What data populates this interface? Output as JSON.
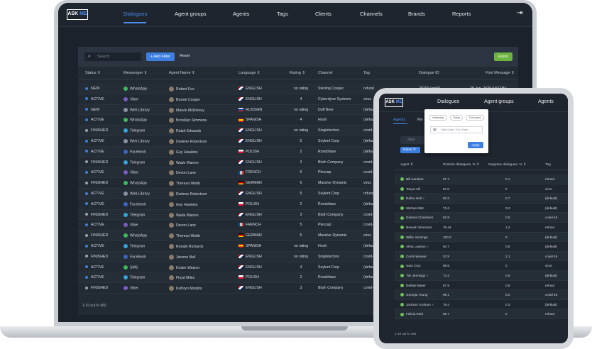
{
  "laptop": {
    "logo": {
      "left": "ASK",
      "right": "ME"
    },
    "nav": [
      "Dialogues",
      "Agent groups",
      "Agents",
      "Tags",
      "Clients",
      "Channels",
      "Brands",
      "Reports"
    ],
    "active_nav": "Dialogues",
    "filter": {
      "search_placeholder": "Search",
      "add_filter": "+ Add Filter",
      "reset": "Reset",
      "excel": "Excel"
    },
    "columns": [
      "Status ⇕",
      "Messenger ⇕",
      "Agent Name ⇕",
      "Language ⇕",
      "Rating ⇕",
      "Channel",
      "Tag",
      "Dialogue ID",
      "First Message ⇕"
    ],
    "rows": [
      {
        "status": "NEW",
        "status_color": "#3d7fe0",
        "messenger": "WhatsApp",
        "msg_color": "#3dbb5a",
        "agent": "Robert Fox",
        "language": "ENGLISH",
        "flag": "en",
        "rating": "no rating",
        "channel": "Sterling Cooper",
        "tag": "refund",
        "dialogue_id": "28200-kqp93...",
        "first_message": "28 Jan, 2020 6:57 PM"
      },
      {
        "status": "ACTIVE",
        "status_color": "#3d7fe0",
        "messenger": "Viber",
        "msg_color": "#7a5bc7",
        "agent": "Bessie Cooper",
        "language": "ENGLISH",
        "flag": "en",
        "rating": "4",
        "channel": "Cyberdyne Systems",
        "tag": "virus",
        "dialogue_id": "",
        "first_message": ""
      },
      {
        "status": "NEW",
        "status_color": "#3d7fe0",
        "messenger": "Web Library",
        "msg_color": "#8b93a0",
        "agent": "Marvin McKinney",
        "language": "RUSSIAN",
        "flag": "ru",
        "rating": "no rating",
        "channel": "Duff Beer",
        "tag": "(default)",
        "dialogue_id": "",
        "first_message": ""
      },
      {
        "status": "ACTIVE",
        "status_color": "#3d7fe0",
        "messenger": "WhatsApp",
        "msg_color": "#3dbb5a",
        "agent": "Brooklyn Simmons",
        "language": "SPANISH",
        "flag": "es",
        "rating": "4",
        "channel": "Hooli",
        "tag": "(default)",
        "dialogue_id": "",
        "first_message": ""
      },
      {
        "status": "FINISHED",
        "status_color": "#9aa2ad",
        "messenger": "Telegram",
        "msg_color": "#36a3dc",
        "agent": "Ralph Edwards",
        "language": "ENGLISH",
        "flag": "en",
        "rating": "no rating",
        "channel": "Singletechno",
        "tag": "covid-",
        "dialogue_id": "",
        "first_message": ""
      },
      {
        "status": "ACTIVE",
        "status_color": "#3d7fe0",
        "messenger": "Web Library",
        "msg_color": "#8b93a0",
        "agent": "Darlene Robertson",
        "language": "ENGLISH",
        "flag": "en",
        "rating": "5",
        "channel": "Soylent Corp",
        "tag": "(defau",
        "dialogue_id": "",
        "first_message": ""
      },
      {
        "status": "ACTIVE",
        "status_color": "#3d7fe0",
        "messenger": "Facebook",
        "msg_color": "#3b66c4",
        "agent": "Guy Hawkins",
        "language": "POLISH",
        "flag": "pl",
        "rating": "2",
        "channel": "Rundofase",
        "tag": "(defau",
        "dialogue_id": "",
        "first_message": ""
      },
      {
        "status": "FINISHED",
        "status_color": "#9aa2ad",
        "messenger": "Telegram",
        "msg_color": "#36a3dc",
        "agent": "Wade Warren",
        "language": "ENGLISH",
        "flag": "en",
        "rating": "3",
        "channel": "Bluth Company",
        "tag": "covid-",
        "dialogue_id": "",
        "first_message": ""
      },
      {
        "status": "ACTIVE",
        "status_color": "#3d7fe0",
        "messenger": "Viber",
        "msg_color": "#7a5bc7",
        "agent": "Devon Lane",
        "language": "FRENCH",
        "flag": "fr",
        "rating": "5",
        "channel": "Plexzap",
        "tag": "covid-",
        "dialogue_id": "",
        "first_message": ""
      },
      {
        "status": "FINISHED",
        "status_color": "#9aa2ad",
        "messenger": "WhatsApp",
        "msg_color": "#3dbb5a",
        "agent": "Theresa Webb",
        "language": "GERMAN",
        "flag": "de",
        "rating": "5",
        "channel": "Massive Dynamic",
        "tag": "virus",
        "dialogue_id": "",
        "first_message": ""
      },
      {
        "status": "ACTIVE",
        "status_color": "#3d7fe0",
        "messenger": "Web Library",
        "msg_color": "#8b93a0",
        "agent": "Darlene Robertson",
        "language": "ENGLISH",
        "flag": "en",
        "rating": "5",
        "channel": "Soylent Corp",
        "tag": "refund",
        "dialogue_id": "",
        "first_message": ""
      },
      {
        "status": "ACTIVE",
        "status_color": "#3d7fe0",
        "messenger": "Facebook",
        "msg_color": "#3b66c4",
        "agent": "Guy Hawkins",
        "language": "POLISH",
        "flag": "pl",
        "rating": "2",
        "channel": "Rundofase",
        "tag": "(defau",
        "dialogue_id": "",
        "first_message": ""
      },
      {
        "status": "FINISHED",
        "status_color": "#9aa2ad",
        "messenger": "Telegram",
        "msg_color": "#36a3dc",
        "agent": "Wade Warren",
        "language": "ENGLISH",
        "flag": "en",
        "rating": "3",
        "channel": "Bluth Company",
        "tag": "covid-",
        "dialogue_id": "",
        "first_message": ""
      },
      {
        "status": "ACTIVE",
        "status_color": "#3d7fe0",
        "messenger": "Viber",
        "msg_color": "#7a5bc7",
        "agent": "Devon Lane",
        "language": "FRENCH",
        "flag": "fr",
        "rating": "5",
        "channel": "Plexzap",
        "tag": "covid-",
        "dialogue_id": "",
        "first_message": ""
      },
      {
        "status": "FINISHED",
        "status_color": "#9aa2ad",
        "messenger": "WhatsApp",
        "msg_color": "#3dbb5a",
        "agent": "Theresa Webb",
        "language": "GERMAN",
        "flag": "de",
        "rating": "5",
        "channel": "Massive Dynamic",
        "tag": "virus",
        "dialogue_id": "",
        "first_message": ""
      },
      {
        "status": "ACTIVE",
        "status_color": "#3d7fe0",
        "messenger": "Telegram",
        "msg_color": "#36a3dc",
        "agent": "Ronald Richards",
        "language": "SPANISH",
        "flag": "es",
        "rating": "no rating",
        "channel": "Hooli",
        "tag": "(defau",
        "dialogue_id": "",
        "first_message": ""
      },
      {
        "status": "FINISHED",
        "status_color": "#9aa2ad",
        "messenger": "Facebook",
        "msg_color": "#3b66c4",
        "agent": "Jerome Bell",
        "language": "ENGLISH",
        "flag": "en",
        "rating": "no rating",
        "channel": "Singletechno",
        "tag": "covid-",
        "dialogue_id": "",
        "first_message": ""
      },
      {
        "status": "ACTIVE",
        "status_color": "#3d7fe0",
        "messenger": "SMS",
        "msg_color": "#3dbb5a",
        "agent": "Kristin Watson",
        "language": "ENGLISH",
        "flag": "en",
        "rating": "4",
        "channel": "Soylent Corp",
        "tag": "(defau",
        "dialogue_id": "",
        "first_message": ""
      },
      {
        "status": "ACTIVE",
        "status_color": "#3d7fe0",
        "messenger": "Telegram",
        "msg_color": "#36a3dc",
        "agent": "Floyd Miles",
        "language": "POLISH",
        "flag": "pl",
        "rating": "2",
        "channel": "Rundofase",
        "tag": "(defau",
        "dialogue_id": "",
        "first_message": ""
      },
      {
        "status": "FINISHED",
        "status_color": "#9aa2ad",
        "messenger": "Viber",
        "msg_color": "#7a5bc7",
        "agent": "Kathryn Murphy",
        "language": "ENGLISH",
        "flag": "en",
        "rating": "3",
        "channel": "Bluth Company",
        "tag": "covid-",
        "dialogue_id": "",
        "first_message": ""
      }
    ],
    "pagination": "1-15 out fo 480"
  },
  "tablet": {
    "logo": {
      "left": "ASK",
      "right": "ME"
    },
    "nav": [
      "Dialogues",
      "Agent groups",
      "Agents"
    ],
    "tabs": [
      "Agents",
      "Me"
    ],
    "search_placeholder": "Sear",
    "chip": "Dates ✕",
    "popup": {
      "buttons": [
        "Yesterday",
        "Today",
        "This week"
      ],
      "date_placeholder": "Start Date / End Date",
      "apply": "Apply"
    },
    "columns": [
      "Agent ⇕",
      "Position dialogues, % ⇕",
      "Negative dialogues, % ⇕",
      "Tag"
    ],
    "rows": [
      {
        "agent": "Bill Sanders",
        "pos": "87.7",
        "neg": "0.1",
        "tag": "refund"
      },
      {
        "agent": "Tanya Hill",
        "pos": "87.0",
        "neg": "0",
        "tag": "virus"
      },
      {
        "agent": "Debra Holt ♀",
        "pos": "83.3",
        "neg": "0.7",
        "tag": "(default)"
      },
      {
        "agent": "Michael Mitc",
        "pos": "71.6",
        "neg": "0.2",
        "tag": "(default)"
      },
      {
        "agent": "Dolores Chambers",
        "pos": "82.9",
        "neg": "0.5",
        "tag": "covid-19"
      },
      {
        "agent": "Nevaeh Simmons",
        "pos": "75.44",
        "neg": "1.2",
        "tag": "refund"
      },
      {
        "agent": "Willie Jennings",
        "pos": "100.0",
        "neg": "0",
        "tag": "(default)"
      },
      {
        "agent": "Alma Lawson ♀",
        "pos": "94.7",
        "neg": "0.6",
        "tag": "(default)"
      },
      {
        "agent": "Curtis Weaver",
        "pos": "37.8",
        "neg": "2.1",
        "tag": "covid-19"
      },
      {
        "agent": "Sara Cruz",
        "pos": "96.5",
        "neg": "0",
        "tag": "virus"
      },
      {
        "agent": "Tim Jennings ♀",
        "pos": "74.2",
        "neg": "0.9",
        "tag": "(default)"
      },
      {
        "agent": "Debbie Baker",
        "pos": "87.9",
        "neg": "0.8",
        "tag": "refund"
      },
      {
        "agent": "Georgia Young",
        "pos": "99.1",
        "neg": "0.0",
        "tag": "covid-19"
      },
      {
        "agent": "Jackson Graham ♀",
        "pos": "76.4",
        "neg": "0.3",
        "tag": "(default)"
      },
      {
        "agent": "Felicia Reid",
        "pos": "95.7",
        "neg": "0",
        "tag": "refund"
      }
    ],
    "pagination": "1-15 out fo 480"
  }
}
